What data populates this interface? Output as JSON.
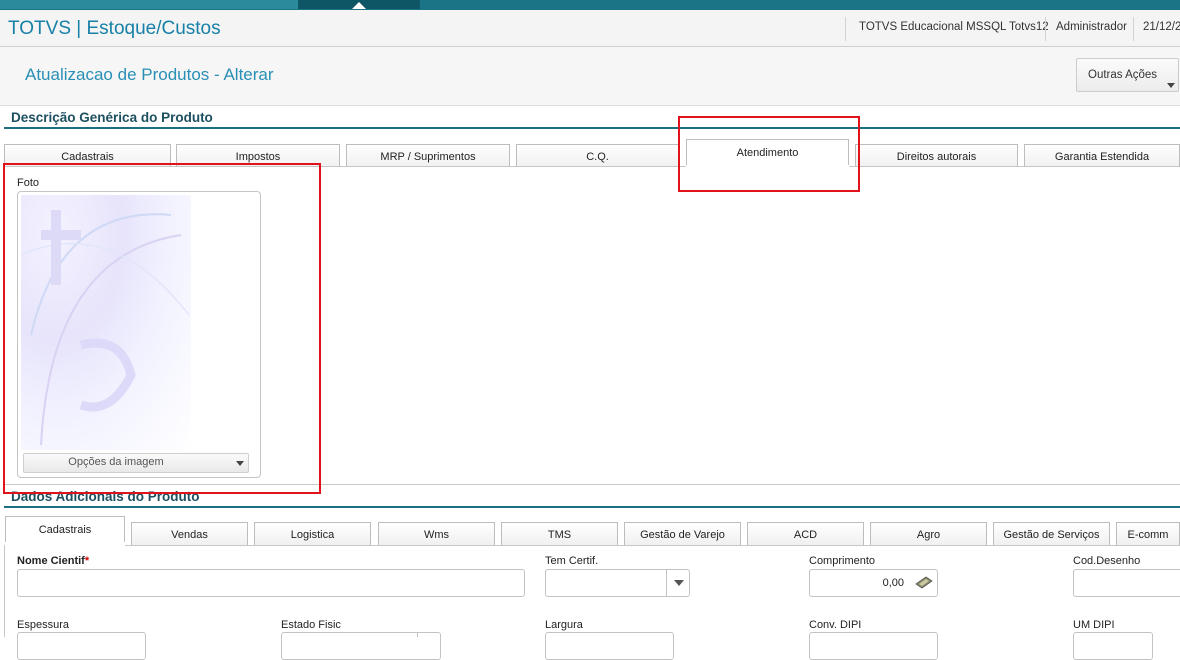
{
  "header": {
    "app_title": "TOTVS | Estoque/Custos",
    "environment": "TOTVS Educacional MSSQL Totvs12",
    "user": "Administrador",
    "date": "21/12/2"
  },
  "page": {
    "title": "Atualizacao de Produtos - Alterar",
    "actions_button": "Outras Ações"
  },
  "section_generic": {
    "title": "Descrição Genérica do Produto",
    "tabs": [
      "Cadastrais",
      "Impostos",
      "MRP / Suprimentos",
      "C.Q.",
      "Atendimento",
      "Direitos autorais",
      "Garantia Estendida"
    ],
    "active_tab": "Atendimento"
  },
  "foto": {
    "label": "Foto",
    "options_button": "Opções da imagem"
  },
  "section_additional": {
    "title": "Dados Adicionais do Produto",
    "tabs": [
      "Cadastrais",
      "Vendas",
      "Logistica",
      "Wms",
      "TMS",
      "Gestão de Varejo",
      "ACD",
      "Agro",
      "Gestão de Serviços",
      "E-comm"
    ],
    "active_tab": "Cadastrais"
  },
  "form": {
    "nome_cientif_label": "Nome Cientif",
    "required_mark": "*",
    "tem_certif_label": "Tem Certif.",
    "comprimento_label": "Comprimento",
    "comprimento_value": "0,00",
    "cod_desenho_label": "Cod.Desenho",
    "espessura_label": "Espessura",
    "estado_fisic_label": "Estado Fisic",
    "largura_label": "Largura",
    "conv_dipi_label": "Conv. DIPI",
    "um_dipi_label": "UM DIPI"
  },
  "colors": {
    "brand_teal": "#1b7485",
    "title_blue": "#2a8fb5",
    "highlight_red": "#e0131c"
  }
}
